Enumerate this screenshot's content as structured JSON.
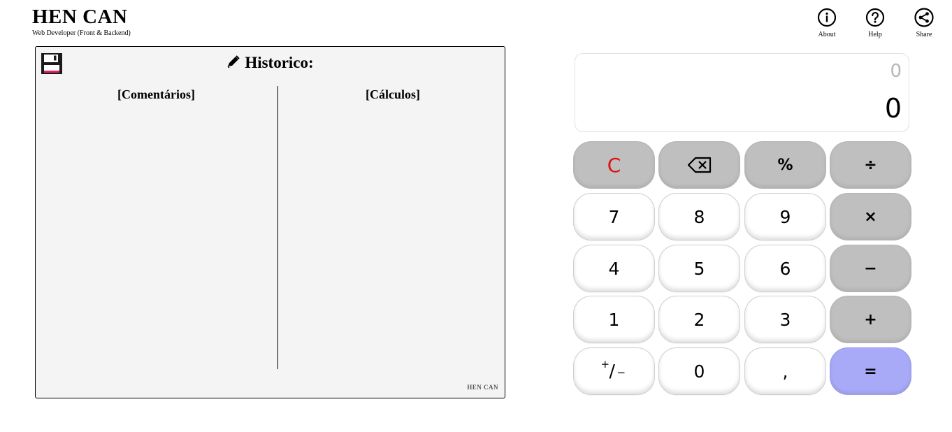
{
  "header": {
    "title": "HEN CAN",
    "subtitle": "Web Developer (Front & Backend)",
    "actions": [
      {
        "label": "About",
        "icon": "info-icon"
      },
      {
        "label": "Help",
        "icon": "help-icon"
      },
      {
        "label": "Share",
        "icon": "share-icon"
      }
    ]
  },
  "history": {
    "title": "Historico:",
    "columns": {
      "comments": "[Comentários]",
      "calculations": "[Cálculos]"
    },
    "footer": "HEN CAN",
    "save_icon": "floppy-disk-icon",
    "title_icon": "pencil-icon"
  },
  "display": {
    "previous": "0",
    "current": "0"
  },
  "keys": {
    "clear": "C",
    "backspace": "⌫",
    "percent": "%",
    "divide": "÷",
    "seven": "7",
    "eight": "8",
    "nine": "9",
    "multiply": "×",
    "four": "4",
    "five": "5",
    "six": "6",
    "minus": "−",
    "one": "1",
    "two": "2",
    "three": "3",
    "plus": "+",
    "negate_plus": "+",
    "negate_slash": "/",
    "negate_minus": "−",
    "zero": "0",
    "comma": ",",
    "equals": "="
  },
  "colors": {
    "operator_key": "#bfbfbf",
    "equals_key": "#a8a9f7",
    "clear_text": "#e01010",
    "panel_bg": "#f4f4f4"
  }
}
